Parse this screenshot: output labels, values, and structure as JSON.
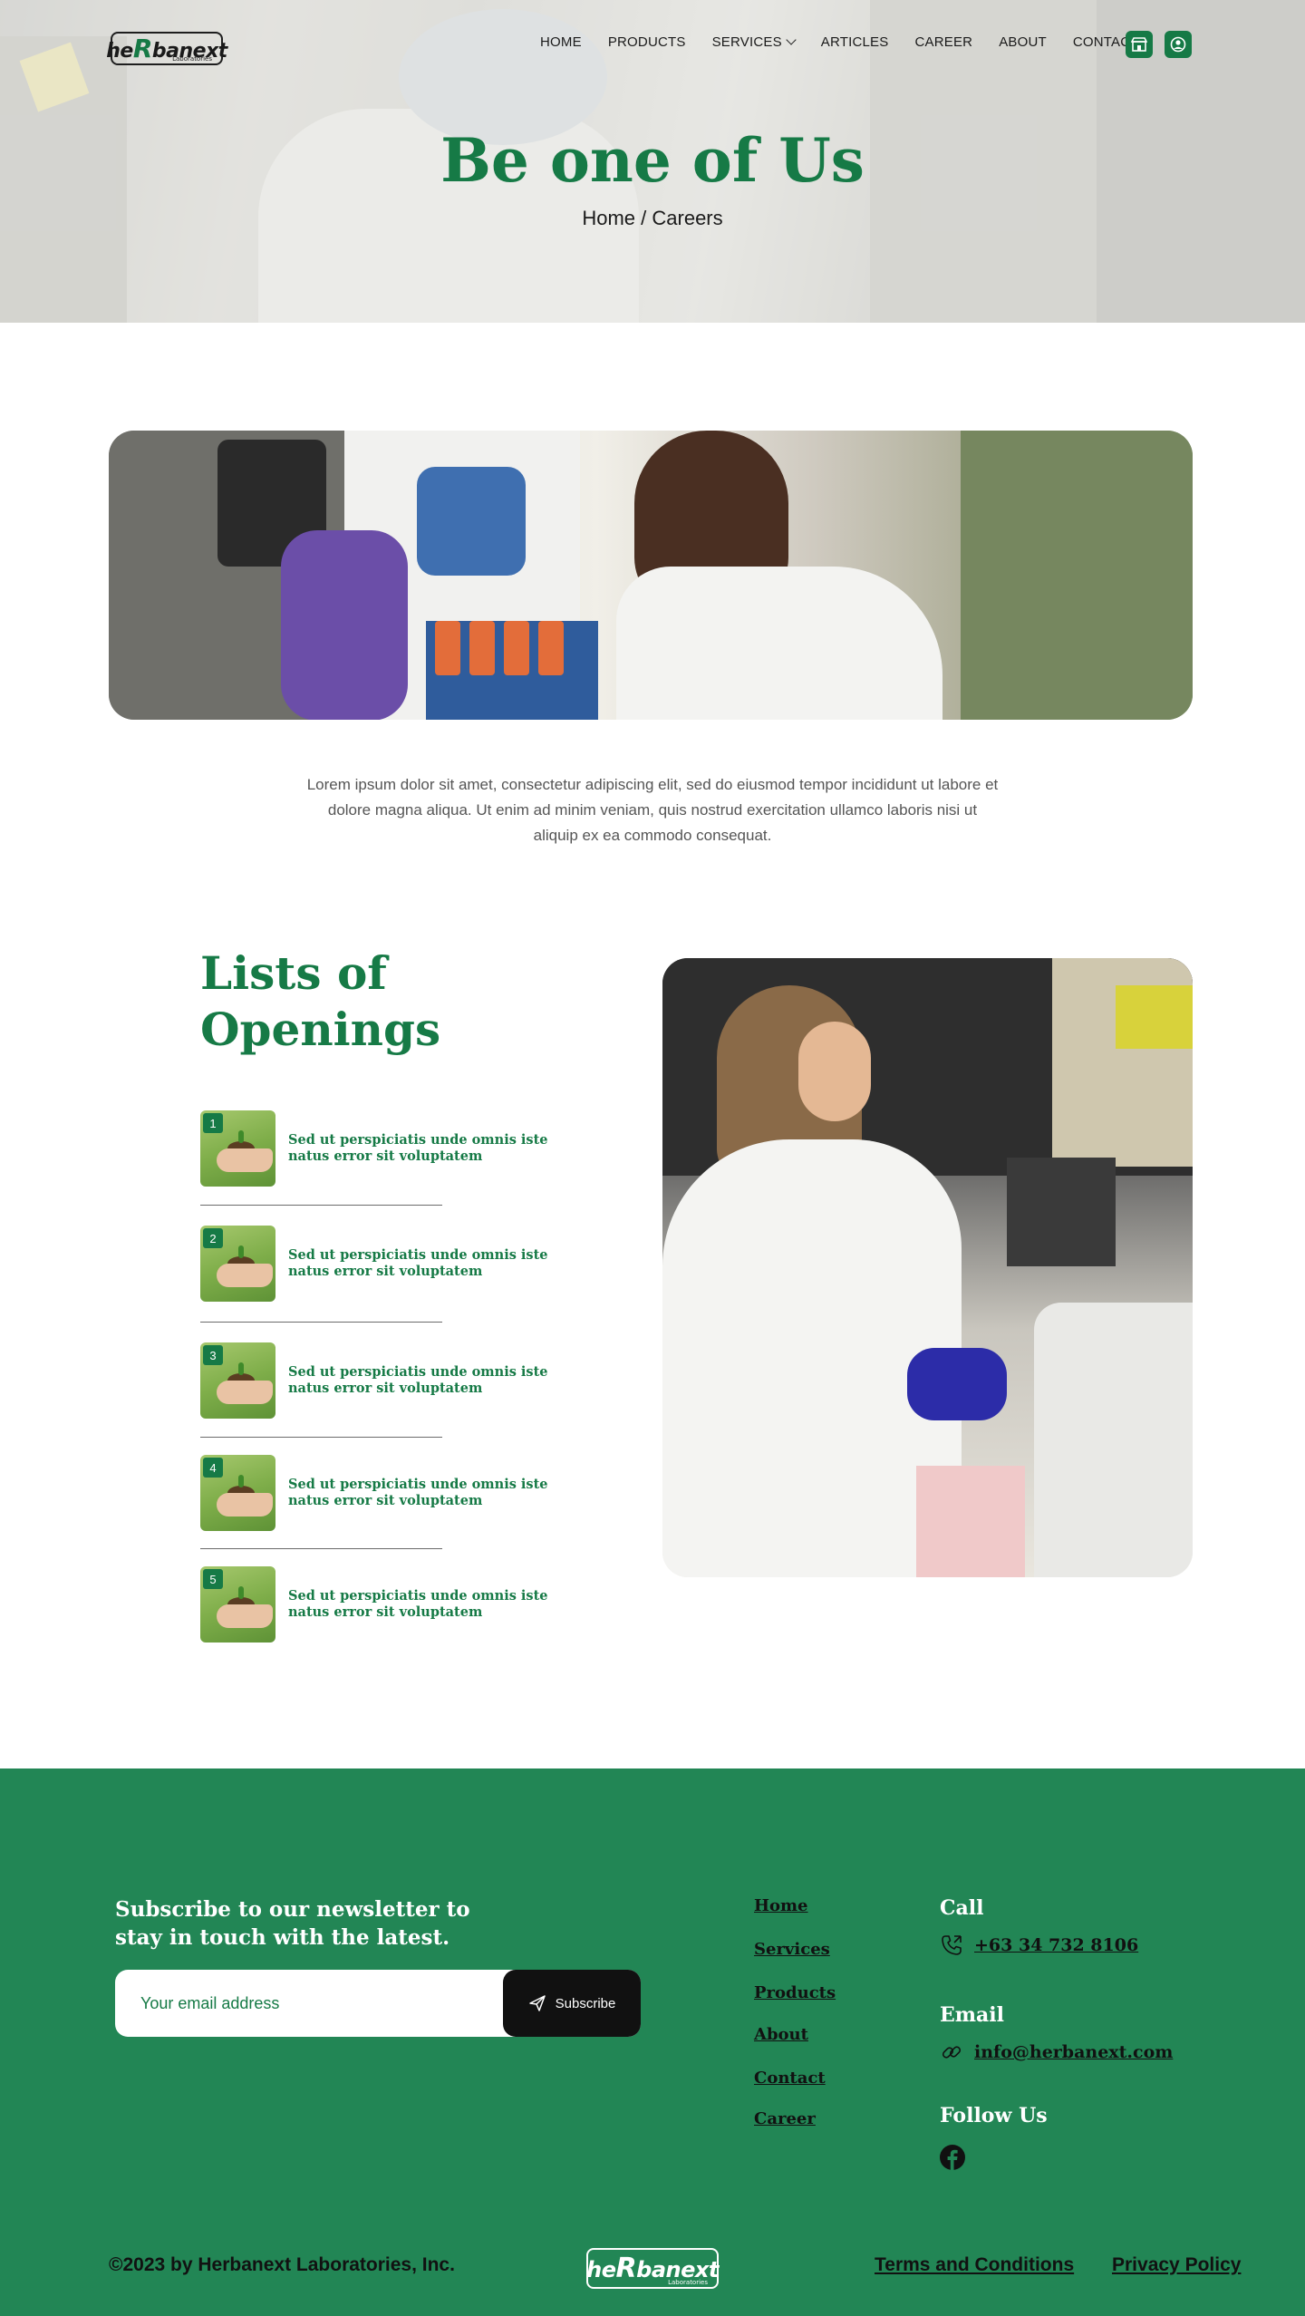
{
  "header": {
    "logo_text_prefix": "he",
    "logo_text_r": "R",
    "logo_text_suffix": "banext",
    "logo_sub": "Laboratories",
    "nav": [
      "HOME",
      "PRODUCTS",
      "SERVICES",
      "ARTICLES",
      "CAREER",
      "ABOUT",
      "CONTACT"
    ],
    "icons": [
      "store-icon",
      "user-icon"
    ]
  },
  "hero": {
    "title": "Be one of Us",
    "breadcrumb": "Home / Careers"
  },
  "intro": {
    "text": "Lorem ipsum dolor sit amet, consectetur adipiscing elit, sed do eiusmod tempor incididunt ut labore et dolore magna aliqua. Ut enim ad minim veniam, quis nostrud exercitation ullamco laboris nisi ut aliquip ex ea commodo consequat."
  },
  "openings": {
    "title": "Lists of Openings",
    "items": [
      {
        "number": "1",
        "text": "Sed ut perspiciatis unde omnis iste natus error sit voluptatem"
      },
      {
        "number": "2",
        "text": "Sed ut perspiciatis unde omnis iste natus error sit voluptatem"
      },
      {
        "number": "3",
        "text": "Sed ut perspiciatis unde omnis iste natus error sit voluptatem"
      },
      {
        "number": "4",
        "text": "Sed ut perspiciatis unde omnis iste natus error sit voluptatem"
      },
      {
        "number": "5",
        "text": "Sed ut perspiciatis unde omnis iste natus error sit voluptatem"
      }
    ]
  },
  "footer": {
    "newsletter_title": "Subscribe to our newsletter to stay in touch with the latest.",
    "email_placeholder": "Your email address",
    "subscribe_label": "Subscribe",
    "links": [
      "Home",
      "Services",
      "Products",
      "About",
      "Contact",
      "Career"
    ],
    "call_heading": "Call",
    "phone": "+63 34 732 8106",
    "email_heading": "Email",
    "email": "info@herbanext.com",
    "follow_heading": "Follow Us",
    "copyright": "©2023 by Herbanext Laboratories, Inc.",
    "terms": "Terms and Conditions",
    "privacy": "Privacy Policy"
  },
  "colors": {
    "brand_green": "#167a46",
    "footer_green": "#228655",
    "button_dark": "#111111"
  }
}
